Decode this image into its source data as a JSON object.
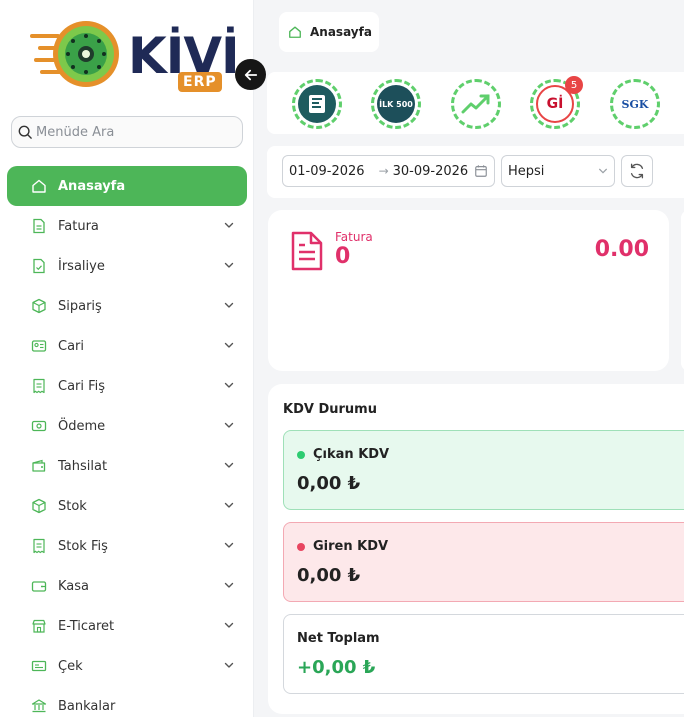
{
  "app": {
    "logo_text": "KİVİ",
    "logo_sub": "ERP"
  },
  "sidebar": {
    "search_placeholder": "Menüde Ara",
    "items": [
      {
        "label": "Anasayfa",
        "icon": "home-icon",
        "active": true,
        "expandable": false
      },
      {
        "label": "Fatura",
        "icon": "invoice-icon",
        "expandable": true
      },
      {
        "label": "İrsaliye",
        "icon": "waybill-icon",
        "expandable": true
      },
      {
        "label": "Sipariş",
        "icon": "box-icon",
        "expandable": true
      },
      {
        "label": "Cari",
        "icon": "contact-card-icon",
        "expandable": true
      },
      {
        "label": "Cari Fiş",
        "icon": "receipt-icon",
        "expandable": true
      },
      {
        "label": "Ödeme",
        "icon": "payment-icon",
        "expandable": true
      },
      {
        "label": "Tahsilat",
        "icon": "wallet-icon",
        "expandable": true
      },
      {
        "label": "Stok",
        "icon": "package-icon",
        "expandable": true
      },
      {
        "label": "Stok Fiş",
        "icon": "stock-receipt-icon",
        "expandable": true
      },
      {
        "label": "Kasa",
        "icon": "cash-box-icon",
        "expandable": true
      },
      {
        "label": "E-Ticaret",
        "icon": "store-icon",
        "expandable": true
      },
      {
        "label": "Çek",
        "icon": "cheque-icon",
        "expandable": true
      },
      {
        "label": "Bankalar",
        "icon": "bank-icon",
        "expandable": false
      }
    ]
  },
  "breadcrumb": {
    "label": "Anasayfa"
  },
  "quick_links": [
    {
      "name": "dashboard-report",
      "badge": null
    },
    {
      "name": "ilk-500",
      "label": "İLK 500",
      "badge": null
    },
    {
      "name": "growth-chart",
      "badge": null
    },
    {
      "name": "gib",
      "label": "Gİ",
      "badge": "5"
    },
    {
      "name": "sgk",
      "label": "SGK",
      "badge": null
    }
  ],
  "filters": {
    "start_date": "01-09-2026",
    "end_date": "30-09-2026",
    "select_value": "Hepsi"
  },
  "invoice_summary": {
    "label": "Fatura",
    "count": "0",
    "amount": "0.00"
  },
  "kdv": {
    "title": "KDV Durumu",
    "outgoing": {
      "label": "Çıkan KDV",
      "value": "0,00 ₺"
    },
    "incoming": {
      "label": "Giren KDV",
      "value": "0,00 ₺"
    },
    "net": {
      "label": "Net Toplam",
      "value": "+0,00 ₺"
    }
  },
  "colors": {
    "primary_green": "#4db658",
    "invoice_pink": "#e0306a",
    "logo_navy": "#1f2a56",
    "logo_orange": "#e5902a"
  }
}
